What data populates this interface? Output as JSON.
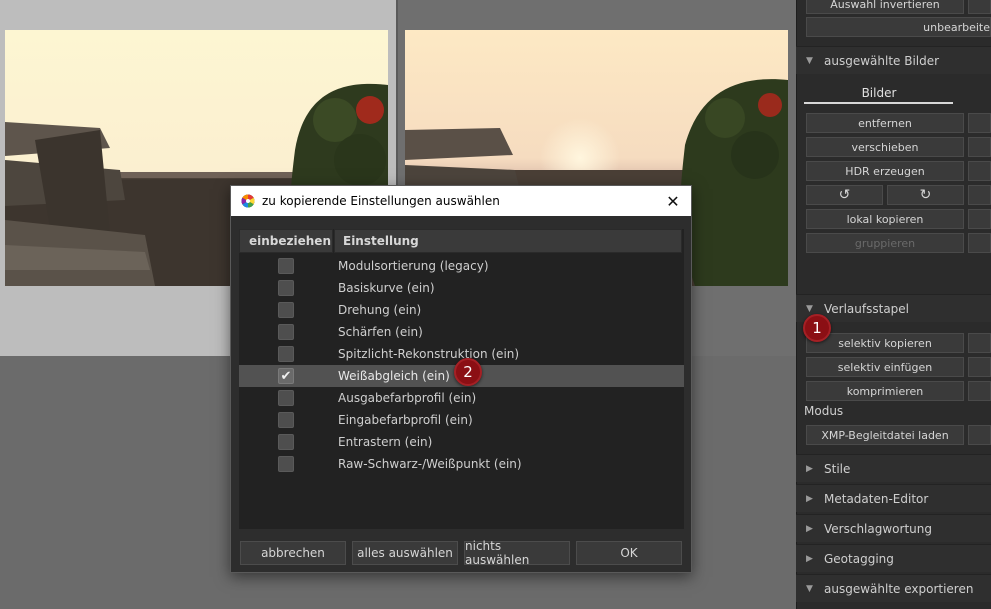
{
  "right_panel": {
    "top_buttons": [
      "Auswahl invertieren",
      "unbearbeite"
    ],
    "sections": {
      "selected_images": {
        "title": "ausgewählte Bilder",
        "tab": "Bilder",
        "buttons": [
          "entfernen",
          "verschieben",
          "HDR erzeugen",
          "lokal kopieren",
          "gruppieren"
        ],
        "rotate_icons": [
          "rotate-left-icon",
          "rotate-right-icon"
        ]
      },
      "history_stack": {
        "title": "Verlaufsstapel",
        "buttons": [
          "selektiv kopieren",
          "selektiv einfügen",
          "komprimieren"
        ],
        "mode_label": "Modus",
        "xmp_button": "XMP-Begleitdatei laden"
      },
      "collapsed": [
        "Stile",
        "Metadaten-Editor",
        "Verschlagwortung",
        "Geotagging"
      ],
      "export": {
        "title": "ausgewählte exportieren"
      }
    }
  },
  "badges": [
    "1",
    "2"
  ],
  "dialog": {
    "title": "zu kopierende Einstellungen auswählen",
    "columns": [
      "einbeziehen",
      "Einstellung"
    ],
    "rows": [
      {
        "label": "Modulsortierung (legacy)",
        "checked": false,
        "selected": false
      },
      {
        "label": "Basiskurve  (ein)",
        "checked": false,
        "selected": false
      },
      {
        "label": "Drehung  (ein)",
        "checked": false,
        "selected": false
      },
      {
        "label": "Schärfen  (ein)",
        "checked": false,
        "selected": false
      },
      {
        "label": "Spitzlicht-Rekonstruktion  (ein)",
        "checked": false,
        "selected": false
      },
      {
        "label": "Weißabgleich  (ein)",
        "checked": true,
        "selected": true
      },
      {
        "label": "Ausgabefarbprofil  (ein)",
        "checked": false,
        "selected": false
      },
      {
        "label": "Eingabefarbprofil  (ein)",
        "checked": false,
        "selected": false
      },
      {
        "label": "Entrastern  (ein)",
        "checked": false,
        "selected": false
      },
      {
        "label": "Raw-Schwarz-/Weißpunkt  (ein)",
        "checked": false,
        "selected": false
      }
    ],
    "buttons": [
      "abbrechen",
      "alles auswählen",
      "nichts auswählen",
      "OK"
    ]
  },
  "colors": {
    "badge": "#8b0f14",
    "panel_bg": "#2b2b2b",
    "dialog_bg": "#2d2d2d"
  }
}
